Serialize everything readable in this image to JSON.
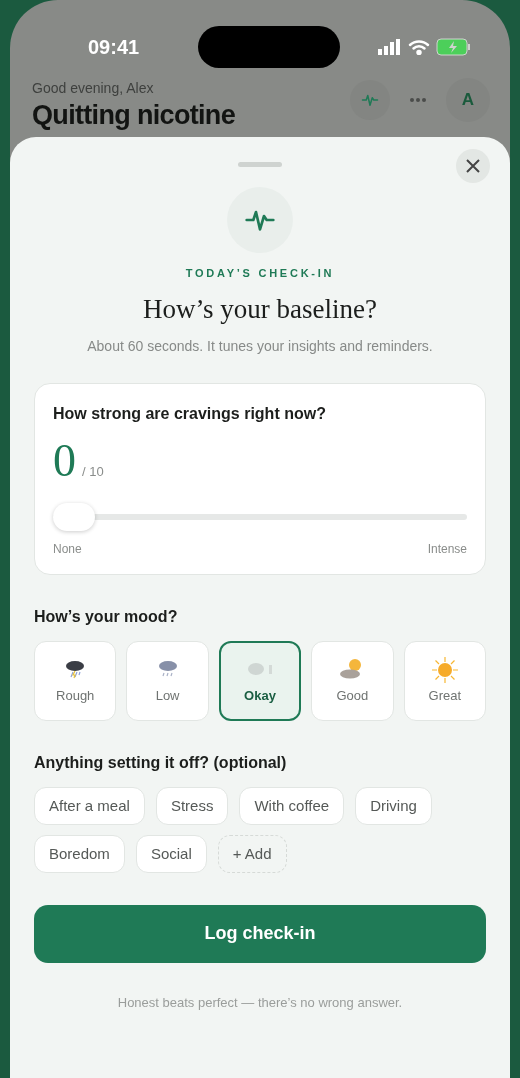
{
  "status_bar": {
    "time": "09:41"
  },
  "header": {
    "greeting": "Good evening, Alex",
    "title": "Quitting nicotine",
    "avatar": "A"
  },
  "sheet": {
    "eyebrow": "TODAY’S CHECK-IN",
    "title": "How’s your baseline?",
    "subtitle": "About 60 seconds. It tunes your insights and reminders.",
    "cravings": {
      "question": "How strong are cravings right now?",
      "value": "0",
      "max": "/ 10",
      "level": 0,
      "min_label": "None",
      "max_label": "Intense"
    },
    "mood": {
      "question": "How’s your mood?",
      "options": [
        {
          "label": "Rough",
          "kind": "storm",
          "selected": false
        },
        {
          "label": "Low",
          "kind": "rain",
          "selected": false
        },
        {
          "label": "Okay",
          "kind": "cloud",
          "selected": true
        },
        {
          "label": "Good",
          "kind": "partly",
          "selected": false
        },
        {
          "label": "Great",
          "kind": "sun",
          "selected": false
        }
      ]
    },
    "triggers": {
      "question": "Anything setting it off? (optional)",
      "chips": [
        {
          "label": "After a meal",
          "kind": "tag",
          "selected": false
        },
        {
          "label": "Stress",
          "kind": "tag",
          "selected": false
        },
        {
          "label": "With coffee",
          "kind": "tag",
          "selected": false
        },
        {
          "label": "Driving",
          "kind": "tag",
          "selected": false
        },
        {
          "label": "Boredom",
          "kind": "tag",
          "selected": false
        },
        {
          "label": "Social",
          "kind": "tag",
          "selected": false
        },
        {
          "label": "+ Add",
          "kind": "add"
        }
      ]
    },
    "submit": "Log check-in",
    "footnote": "Honest beats perfect — there’s no wrong answer."
  }
}
